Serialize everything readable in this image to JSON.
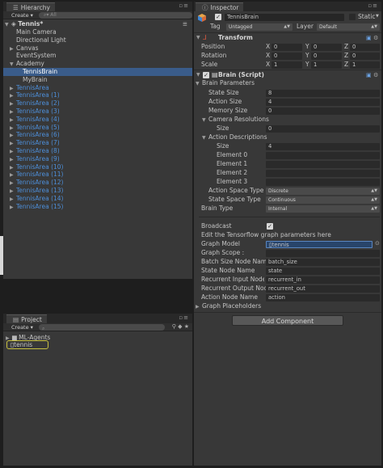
{
  "hierarchy": {
    "tab_label": "Hierarchy",
    "create_label": "Create",
    "search_placeholder": "All",
    "scene": "Tennis*",
    "items": [
      {
        "label": "Main Camera",
        "indent": 1,
        "blue": false,
        "tri": ""
      },
      {
        "label": "Directional Light",
        "indent": 1,
        "blue": false,
        "tri": ""
      },
      {
        "label": "Canvas",
        "indent": 1,
        "blue": false,
        "tri": "▶"
      },
      {
        "label": "EventSystem",
        "indent": 1,
        "blue": false,
        "tri": ""
      },
      {
        "label": "Academy",
        "indent": 1,
        "blue": false,
        "tri": "▼"
      },
      {
        "label": "TennisBrain",
        "indent": 2,
        "blue": false,
        "tri": "",
        "selected": true
      },
      {
        "label": "MyBrain",
        "indent": 2,
        "blue": false,
        "tri": ""
      },
      {
        "label": "TennisArea",
        "indent": 1,
        "blue": true,
        "tri": "▶"
      },
      {
        "label": "TennisArea (1)",
        "indent": 1,
        "blue": true,
        "tri": "▶"
      },
      {
        "label": "TennisArea (2)",
        "indent": 1,
        "blue": true,
        "tri": "▶"
      },
      {
        "label": "TennisArea (3)",
        "indent": 1,
        "blue": true,
        "tri": "▶"
      },
      {
        "label": "TennisArea (4)",
        "indent": 1,
        "blue": true,
        "tri": "▶"
      },
      {
        "label": "TennisArea (5)",
        "indent": 1,
        "blue": true,
        "tri": "▶"
      },
      {
        "label": "TennisArea (6)",
        "indent": 1,
        "blue": true,
        "tri": "▶"
      },
      {
        "label": "TennisArea (7)",
        "indent": 1,
        "blue": true,
        "tri": "▶"
      },
      {
        "label": "TennisArea (8)",
        "indent": 1,
        "blue": true,
        "tri": "▶"
      },
      {
        "label": "TennisArea (9)",
        "indent": 1,
        "blue": true,
        "tri": "▶"
      },
      {
        "label": "TennisArea (10)",
        "indent": 1,
        "blue": true,
        "tri": "▶"
      },
      {
        "label": "TennisArea (11)",
        "indent": 1,
        "blue": true,
        "tri": "▶"
      },
      {
        "label": "TennisArea (12)",
        "indent": 1,
        "blue": true,
        "tri": "▶"
      },
      {
        "label": "TennisArea (13)",
        "indent": 1,
        "blue": true,
        "tri": "▶"
      },
      {
        "label": "TennisArea (14)",
        "indent": 1,
        "blue": true,
        "tri": "▶"
      },
      {
        "label": "TennisArea (15)",
        "indent": 1,
        "blue": true,
        "tri": "▶"
      }
    ]
  },
  "project": {
    "tab_label": "Project",
    "create_label": "Create",
    "items": [
      {
        "label": "ML-Agents",
        "type": "folder"
      },
      {
        "label": "tennis",
        "type": "file"
      }
    ]
  },
  "inspector": {
    "tab_label": "Inspector",
    "object_name": "TennisBrain",
    "static_label": "Static",
    "tag_label": "Tag",
    "tag_value": "Untagged",
    "layer_label": "Layer",
    "layer_value": "Default",
    "transform": {
      "title": "Transform",
      "rows": [
        {
          "label": "Position",
          "x": "0",
          "y": "0",
          "z": "0"
        },
        {
          "label": "Rotation",
          "x": "0",
          "y": "0",
          "z": "0"
        },
        {
          "label": "Scale",
          "x": "1",
          "y": "1",
          "z": "1"
        }
      ],
      "axis_x": "X",
      "axis_y": "Y",
      "axis_z": "Z"
    },
    "brain": {
      "title": "Brain (Script)",
      "params_label": "Brain Parameters",
      "state_size_label": "State Size",
      "state_size": "8",
      "action_size_label": "Action Size",
      "action_size": "4",
      "memory_size_label": "Memory Size",
      "memory_size": "0",
      "camera_res_label": "Camera Resolutions",
      "camera_size_label": "Size",
      "camera_size": "0",
      "action_desc_label": "Action Descriptions",
      "action_desc_size_label": "Size",
      "action_desc_size": "4",
      "elements": [
        "Element 0",
        "Element 1",
        "Element 2",
        "Element 3"
      ],
      "action_space_label": "Action Space Type",
      "action_space": "Discrete",
      "state_space_label": "State Space Type",
      "state_space": "Continuous",
      "brain_type_label": "Brain Type",
      "brain_type": "Internal",
      "broadcast_label": "Broadcast",
      "edit_label": "Edit the Tensorflow graph parameters here",
      "graph_model_label": "Graph Model",
      "graph_model": "tennis",
      "graph_scope_label": "Graph Scope :",
      "batch_label": "Batch Size Node Name",
      "batch_value": "batch_size",
      "state_node_label": "State Node Name",
      "state_node_value": "state",
      "rec_in_label": "Recurrent Input Node N",
      "rec_in_value": "recurrent_in",
      "rec_out_label": "Recurrent Output Node N",
      "rec_out_value": "recurrent_out",
      "action_node_label": "Action Node Name",
      "action_node_value": "action",
      "placeholders_label": "Graph Placeholders"
    },
    "add_component": "Add Component"
  },
  "colors": {
    "accent_blue": "#4d8ed8",
    "selection": "#3a5c8a",
    "project_highlight": "#c8c040"
  }
}
